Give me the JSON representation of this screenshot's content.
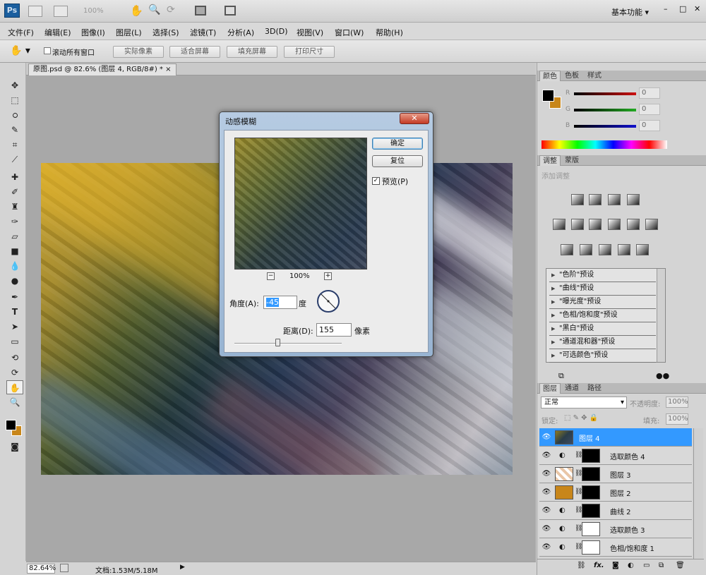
{
  "app": {
    "logo": "Ps",
    "zoom_box": "100%",
    "workspace": "基本功能",
    "window_controls": [
      "–",
      "□",
      "✕"
    ]
  },
  "menu": [
    "文件(F)",
    "编辑(E)",
    "图像(I)",
    "图层(L)",
    "选择(S)",
    "滤镜(T)",
    "分析(A)",
    "3D(D)",
    "视图(V)",
    "窗口(W)",
    "帮助(H)"
  ],
  "options": {
    "scroll_all_label": "滚动所有窗口",
    "buttons": [
      "实际像素",
      "适合屏幕",
      "填充屏幕",
      "打印尺寸"
    ]
  },
  "document": {
    "tab_title": "原图.psd @ 82.6% (图层 4, RGB/8#) *",
    "tab_close": "×"
  },
  "status": {
    "zoom": "82.64%",
    "doc_size": "文档:1.53M/5.18M"
  },
  "dialog": {
    "title": "动感模糊",
    "close": "✕",
    "ok": "确定",
    "reset": "复位",
    "preview_label": "预览(P)",
    "preview_checked": true,
    "zoom_minus": "−",
    "zoom_plus": "+",
    "zoom_value": "100%",
    "angle_label": "角度(A):",
    "angle_value": "-45",
    "angle_unit": "度",
    "distance_label": "距离(D):",
    "distance_value": "155",
    "distance_unit": "像素",
    "distance_slider_fraction": 0.16
  },
  "color_panel": {
    "tabs": [
      "颜色",
      "色板",
      "样式"
    ],
    "channels": [
      {
        "label": "R",
        "value": "0",
        "color": "#cc1111"
      },
      {
        "label": "G",
        "value": "0",
        "color": "#22aa22"
      },
      {
        "label": "B",
        "value": "0",
        "color": "#1111cc"
      }
    ],
    "foreground": "#000000",
    "background": "#c8861a"
  },
  "adjust_panel": {
    "tabs": [
      "调整",
      "蒙版"
    ],
    "heading": "添加调整",
    "presets": [
      "\"色阶\"预设",
      "\"曲线\"预设",
      "\"曝光度\"预设",
      "\"色相/饱和度\"预设",
      "\"黑白\"预设",
      "\"通道混和器\"预设",
      "\"可选颜色\"预设"
    ]
  },
  "layers_panel": {
    "tabs": [
      "图层",
      "通道",
      "路径"
    ],
    "blend_mode": "正常",
    "opacity_label": "不透明度:",
    "opacity_value": "100%",
    "lock_label": "锁定:",
    "fill_label": "填充:",
    "fill_value": "100%",
    "layers": [
      {
        "name": "图层 4",
        "selected": true
      },
      {
        "name": "选取颜色 4",
        "selected": false
      },
      {
        "name": "图层 3",
        "selected": false
      },
      {
        "name": "图层 2",
        "selected": false
      },
      {
        "name": "曲线 2",
        "selected": false
      },
      {
        "name": "选取颜色 3",
        "selected": false
      },
      {
        "name": "色相/饱和度 1",
        "selected": false
      }
    ],
    "footer_fx": "fx."
  }
}
